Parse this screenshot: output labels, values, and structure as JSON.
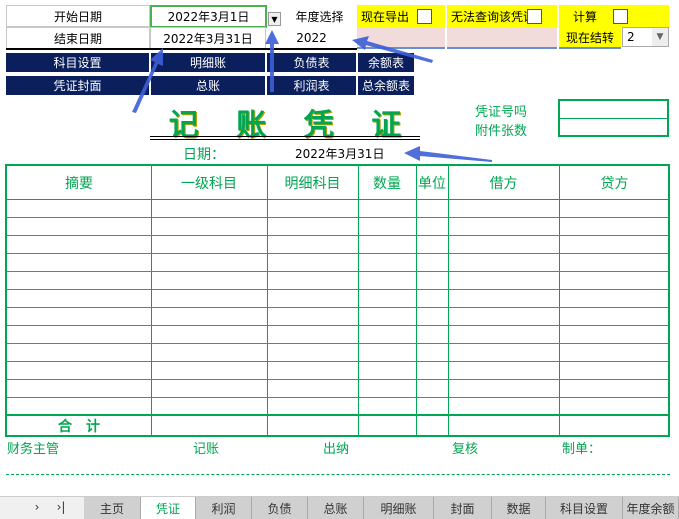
{
  "controls": {
    "start_date_label": "开始日期",
    "start_date": "2022年3月1日",
    "year_select_label": "年度选择",
    "end_date_label": "结束日期",
    "end_date": "2022年3月31日",
    "year": "2022",
    "export_now": "现在导出",
    "cannot_query": "无法查询该凭证",
    "calculate": "计算",
    "carry_forward": "现在结转",
    "carry_value": "2"
  },
  "buttons": [
    "科目设置",
    "明细账",
    "负债表",
    "余额表",
    "凭证封面",
    "总账",
    "利润表",
    "总余额表"
  ],
  "voucher": {
    "title_chars": [
      "记",
      "账",
      "凭",
      "证"
    ],
    "voucher_no_label": "凭证号吗",
    "attachments_label": "附件张数",
    "date_label": "日期：",
    "date": "2022年3月31日",
    "columns": [
      "摘要",
      "一级科目",
      "明细科目",
      "数量",
      "单位",
      "借方",
      "贷方"
    ],
    "total_label": "合　计",
    "signatures": [
      "财务主管",
      "记账",
      "出纳",
      "复核",
      "制单："
    ]
  },
  "sheet_tabs": [
    "主页",
    "凭证",
    "利润",
    "负债",
    "总账",
    "明细账",
    "封面",
    "数据",
    "科目设置",
    "年度余额"
  ],
  "active_tab": "凭证"
}
